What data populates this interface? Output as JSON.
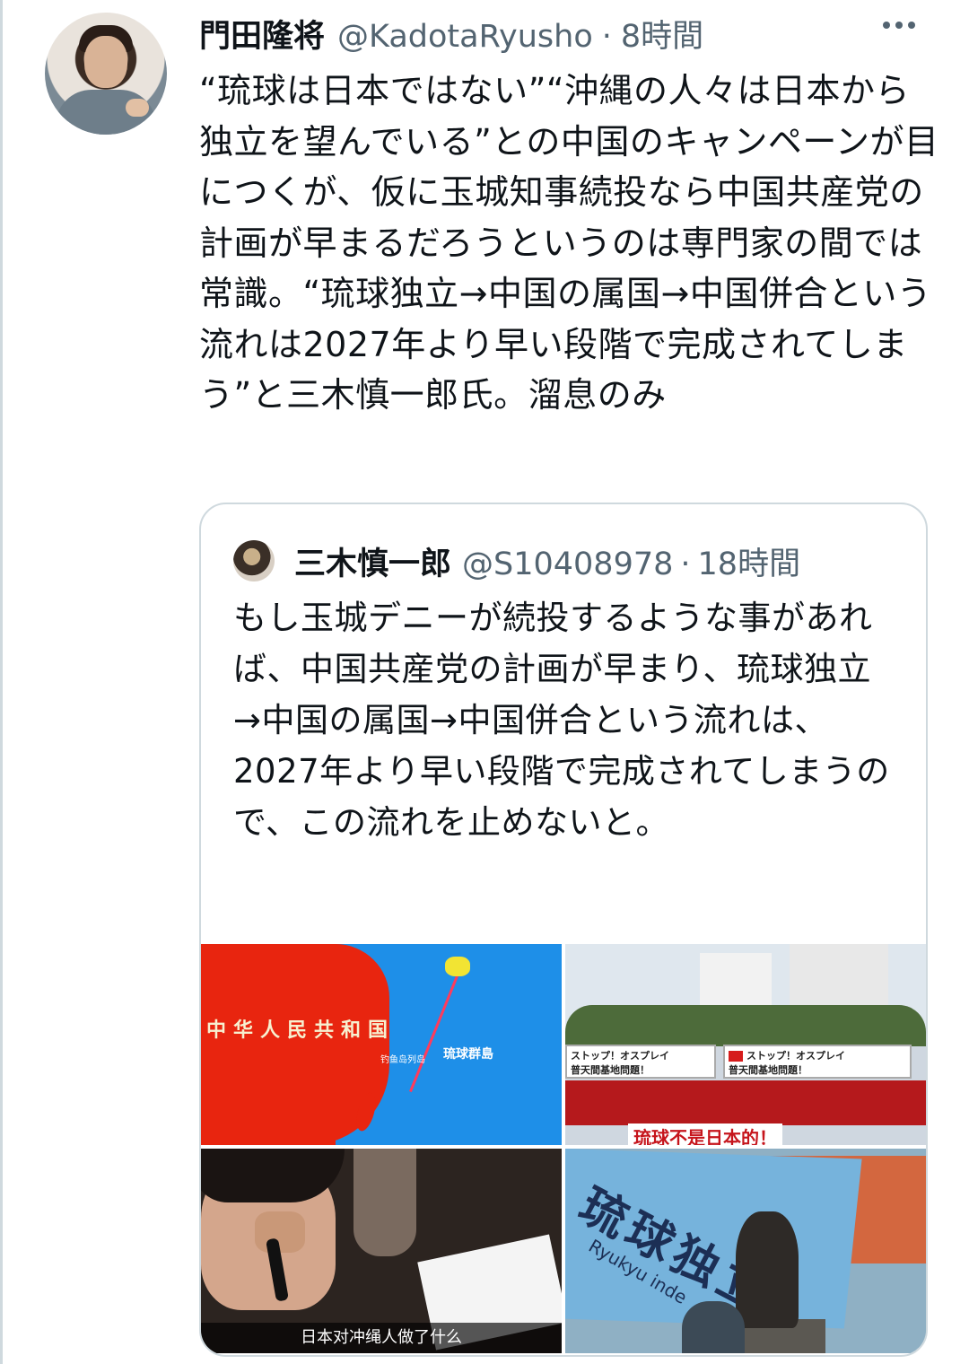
{
  "tweet": {
    "display_name": "門田隆将",
    "handle": "@KadotaRyusho",
    "separator": "·",
    "time": "8時間",
    "text": "“琉球は日本ではない”“沖縄の人々は日本から独立を望んでいる”との中国のキャンペーンが目につくが、仮に玉城知事続投なら中国共産党の計画が早まるだろうというのは専門家の間では常識。“琉球独立→中国の属国→中国併合という流れは2027年より早い段階で完成されてしまう”と三木慎一郎氏。溜息のみ"
  },
  "quoted_tweet": {
    "display_name": "三木慎一郎",
    "handle": "@S10408978",
    "separator": "·",
    "time": "18時間",
    "text": "もし玉城デニーが続投するような事があれば、中国共産党の計画が早まり、琉球独立→中国の属国→中国併合という流れは、2027年より早い段階で完成されてしまうので、この流れを止めないと。",
    "media": {
      "map_label": "中华人民共和国",
      "map_label_islands": "琉球群島",
      "map_label_senkaku": "钓鱼岛列岛",
      "banner_left": "ストップ！オスプレイ",
      "banner_left_sub": "普天間基地問題！",
      "banner_right": "ストップ！オスプレイ",
      "banner_right_sub": "普天間基地問題！",
      "banner_bottom": "琉球不是日本的！",
      "video_caption": "日本对冲绳人做了什么",
      "flag_text": "琉球独立",
      "flag_sub": "Ryukyu inde"
    }
  },
  "icons": {
    "more": "more-horizontal-icon"
  }
}
